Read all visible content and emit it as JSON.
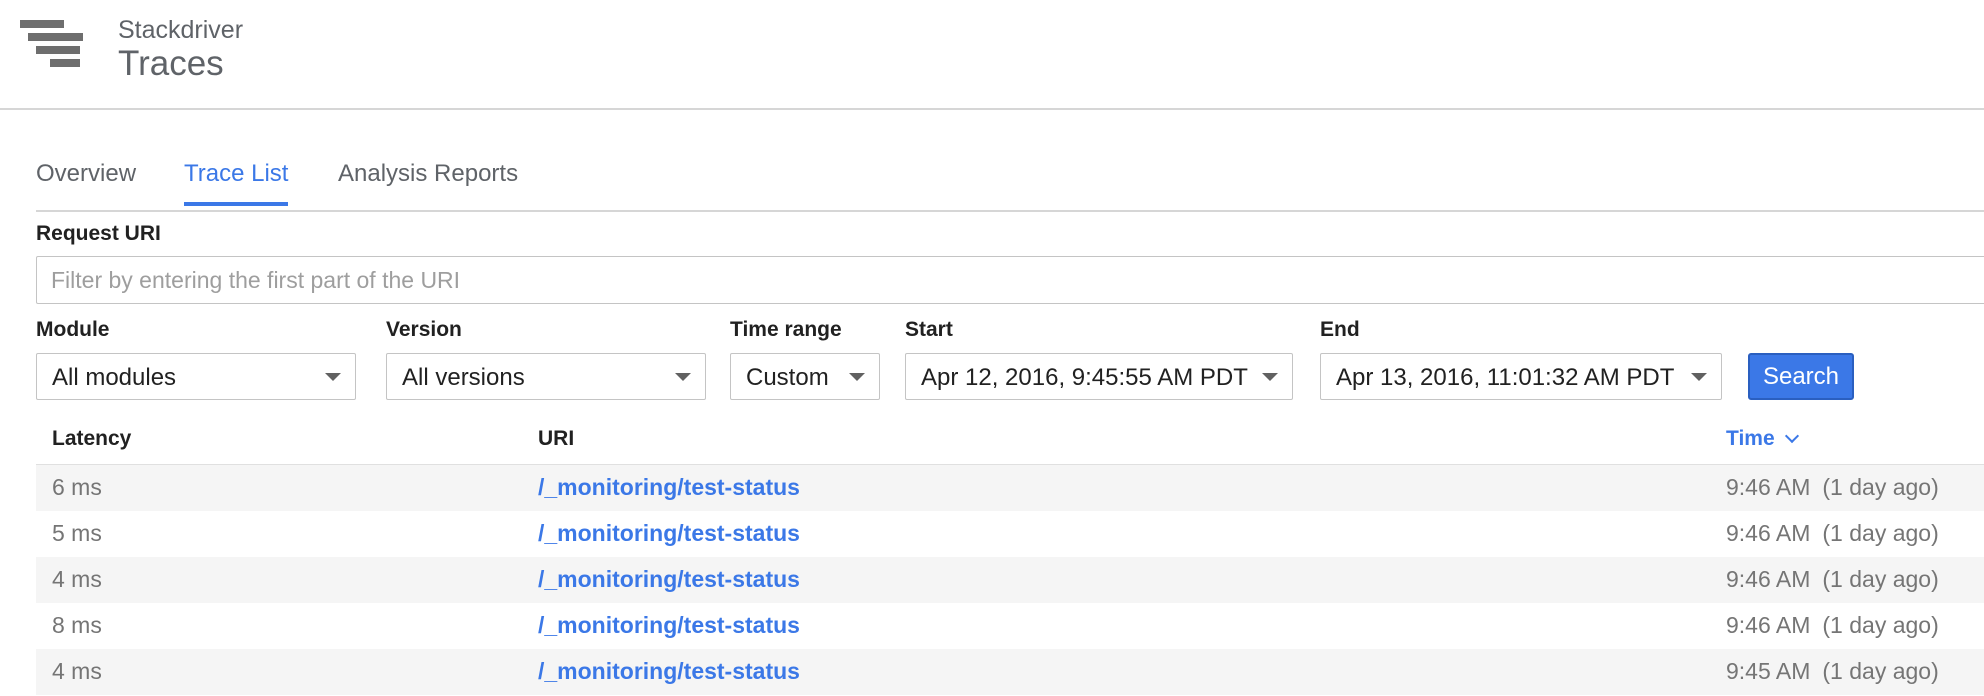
{
  "header": {
    "subtitle": "Stackdriver",
    "title": "Traces"
  },
  "tabs": [
    {
      "label": "Overview",
      "active": false
    },
    {
      "label": "Trace List",
      "active": true
    },
    {
      "label": "Analysis Reports",
      "active": false
    }
  ],
  "filters": {
    "request_uri_label": "Request URI",
    "request_uri_placeholder": "Filter by entering the first part of the URI",
    "request_uri_value": "",
    "module": {
      "label": "Module",
      "value": "All modules"
    },
    "version": {
      "label": "Version",
      "value": "All versions"
    },
    "time_range": {
      "label": "Time range",
      "value": "Custom"
    },
    "start": {
      "label": "Start",
      "value": "Apr 12, 2016, 9:45:55 AM PDT"
    },
    "end": {
      "label": "End",
      "value": "Apr 13, 2016, 11:01:32 AM PDT"
    },
    "search_label": "Search"
  },
  "table": {
    "headers": {
      "latency": "Latency",
      "uri": "URI",
      "time": "Time"
    },
    "sort": {
      "column": "time",
      "direction": "descending",
      "icon": "chevron-down-icon"
    },
    "rows": [
      {
        "latency": "6 ms",
        "uri": "/_monitoring/test-status",
        "time": "9:46 AM",
        "ago": "(1 day ago)"
      },
      {
        "latency": "5 ms",
        "uri": "/_monitoring/test-status",
        "time": "9:46 AM",
        "ago": "(1 day ago)"
      },
      {
        "latency": "4 ms",
        "uri": "/_monitoring/test-status",
        "time": "9:46 AM",
        "ago": "(1 day ago)"
      },
      {
        "latency": "8 ms",
        "uri": "/_monitoring/test-status",
        "time": "9:46 AM",
        "ago": "(1 day ago)"
      },
      {
        "latency": "4 ms",
        "uri": "/_monitoring/test-status",
        "time": "9:45 AM",
        "ago": "(1 day ago)"
      }
    ]
  },
  "icons": {
    "logo": "stackdriver-trace-logo-icon",
    "caret": "caret-down-icon"
  },
  "colors": {
    "accent": "#3b78e7",
    "muted_text": "#757575",
    "row_stripe": "#f5f5f5"
  }
}
